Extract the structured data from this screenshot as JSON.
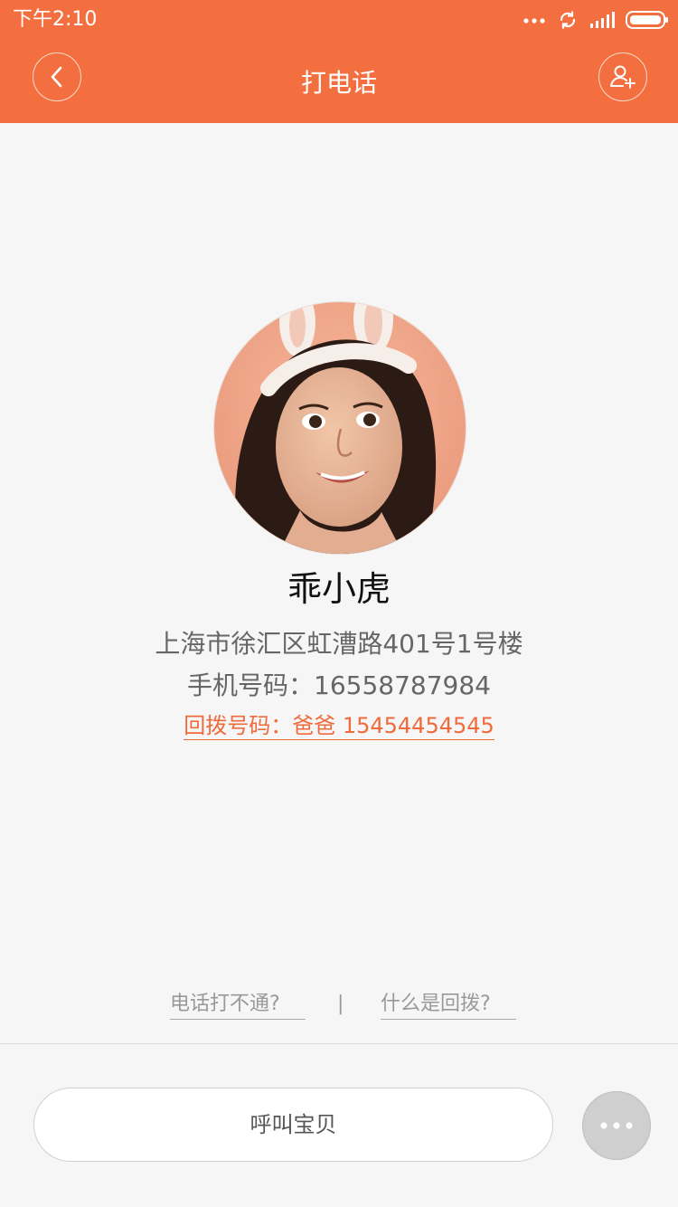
{
  "status_bar": {
    "time": "下午2:10",
    "icons": [
      "more-dots-icon",
      "sync-icon",
      "signal-icon",
      "battery-icon"
    ]
  },
  "header": {
    "title": "打电话",
    "back_icon": "chevron-left-icon",
    "add_contact_icon": "add-user-icon",
    "background_color": "#f46f3f"
  },
  "profile": {
    "name": "乖小虎",
    "address": "上海市徐汇区虹漕路401号1号楼",
    "phone_line": "手机号码：16558787984",
    "callback_line": "回拨号码：爸爸 15454454545"
  },
  "help": {
    "cannot_connect": "电话打不通?",
    "separator": "|",
    "what_is_callback": "什么是回拨?"
  },
  "actions": {
    "call_label": "呼叫宝贝",
    "more_icon": "more-dots-icon"
  },
  "colors": {
    "accent": "#f06b3c",
    "background": "#f6f6f6"
  }
}
